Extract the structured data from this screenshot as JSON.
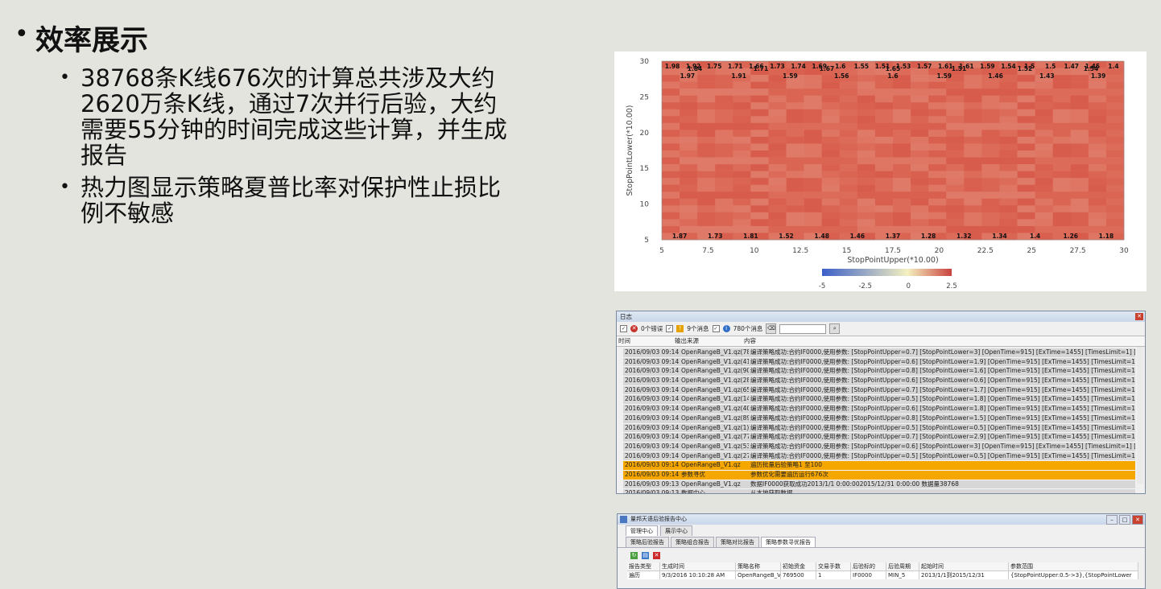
{
  "slide": {
    "title": "效率展示",
    "bullets": [
      "38768条K线676次的计算总共涉及大约2620万条K线，通过7次并行后验，大约需要55分钟的时间完成这些计算，并生成报告",
      "热力图显示策略夏普比率对保护性止损比例不敏感"
    ]
  },
  "heatmap": {
    "xlabel": "StopPointUpper(*10.00)",
    "ylabel": "StopPointLower(*10.00)",
    "x_ticks": [
      "5",
      "7.5",
      "10",
      "12.5",
      "15",
      "17.5",
      "20",
      "22.5",
      "25",
      "27.5",
      "30"
    ],
    "y_ticks": [
      "30",
      "25",
      "20",
      "15",
      "10",
      "5"
    ],
    "colorbar_ticks": [
      "-5",
      "-2.5",
      "0",
      "2.5"
    ],
    "colors": {
      "low": "#3b5fc8",
      "mid": "#f4f0c0",
      "high": "#c9423e",
      "cell": "#db6a58"
    }
  },
  "chart_data": {
    "type": "heatmap",
    "xlabel": "StopPointUpper(*10.00)",
    "ylabel": "StopPointLower(*10.00)",
    "xlim": [
      5,
      30
    ],
    "ylim": [
      5,
      30
    ],
    "color_range": [
      -5,
      2.5
    ],
    "label_samples": {
      "row_30": [
        "1.98",
        "1.92",
        "1.75",
        "1.71",
        "1.66",
        "1.73",
        "1.74",
        "1.69",
        "1.6",
        "1.55",
        "1.51",
        "1.53",
        "1.57",
        "1.61",
        "1.61",
        "1.59",
        "1.54",
        "1.5",
        "1.5",
        "1.47",
        "1.45",
        "1.4"
      ],
      "row_29": [
        "1.84",
        "1.71",
        "1.67",
        "1.65",
        "1.51",
        "1.52",
        "1.54"
      ],
      "row_28": [
        "1.97",
        "1.91",
        "1.59",
        "1.56",
        "1.6",
        "1.59",
        "1.46",
        "1.43",
        "1.39"
      ],
      "row_5": [
        "1.87",
        "1.73",
        "1.81",
        "1.52",
        "1.48",
        "1.46",
        "1.37",
        "1.28",
        "1.32",
        "1.34",
        "1.4",
        "1.26",
        "1.18"
      ]
    }
  },
  "log_window": {
    "title": "日志",
    "filters": {
      "errors": "0个错误",
      "warnings": "9个消息",
      "infos": "780个消息"
    },
    "columns": [
      "时间",
      "输出来源",
      "内容"
    ],
    "rows": [
      [
        "2016/09/03 09:14:10",
        "OpenRangeB_V1.qz(78)",
        "编译策略成功:合约IF0000,使用参数: [StopPointUpper=0.7] [StopPointLower=3] [OpenTime=915] [ExTime=1455] [TimesLimit=1] [RangeRaito=0.3]"
      ],
      [
        "2016/09/03 09:14:10",
        "OpenRangeB_V1.qz(41)",
        "编译策略成功:合约IF0000,使用参数: [StopPointUpper=0.6] [StopPointLower=1.9] [OpenTime=915] [ExTime=1455] [TimesLimit=1] [RangeRaito=0.3]"
      ],
      [
        "2016/09/03 09:14:10",
        "OpenRangeB_V1.qz(90)",
        "编译策略成功:合约IF0000,使用参数: [StopPointUpper=0.8] [StopPointLower=1.6] [OpenTime=915] [ExTime=1455] [TimesLimit=1] [RangeRaito=0.3]"
      ],
      [
        "2016/09/03 09:14:10",
        "OpenRangeB_V1.qz(28)",
        "编译策略成功:合约IF0000,使用参数: [StopPointUpper=0.6] [StopPointLower=0.6] [OpenTime=915] [ExTime=1455] [TimesLimit=1] [RangeRaito=0.3]"
      ],
      [
        "2016/09/03 09:14:09",
        "OpenRangeB_V1.qz(65)",
        "编译策略成功:合约IF0000,使用参数: [StopPointUpper=0.7] [StopPointLower=1.7] [OpenTime=915] [ExTime=1455] [TimesLimit=1] [RangeRaito=0.3]"
      ],
      [
        "2016/09/03 09:14:09",
        "OpenRangeB_V1.qz(14)",
        "编译策略成功:合约IF0000,使用参数: [StopPointUpper=0.5] [StopPointLower=1.8] [OpenTime=915] [ExTime=1455] [TimesLimit=1] [RangeRaito=0.3]"
      ],
      [
        "2016/09/03 09:14:09",
        "OpenRangeB_V1.qz(40)",
        "编译策略成功:合约IF0000,使用参数: [StopPointUpper=0.6] [StopPointLower=1.8] [OpenTime=915] [ExTime=1455] [TimesLimit=1] [RangeRaito=0.3]"
      ],
      [
        "2016/09/03 09:14:09",
        "OpenRangeB_V1.qz(89)",
        "编译策略成功:合约IF0000,使用参数: [StopPointUpper=0.8] [StopPointLower=1.5] [OpenTime=915] [ExTime=1455] [TimesLimit=1] [RangeRaito=0.3]"
      ],
      [
        "2016/09/03 09:14:09",
        "OpenRangeB_V1.qz(1)",
        "编译策略成功:合约IF0000,使用参数: [StopPointUpper=0.5] [StopPointLower=0.5] [OpenTime=915] [ExTime=1455] [TimesLimit=1] [RangeRaito=0.3]"
      ],
      [
        "2016/09/03 09:14:09",
        "OpenRangeB_V1.qz(77)",
        "编译策略成功:合约IF0000,使用参数: [StopPointUpper=0.7] [StopPointLower=2.9] [OpenTime=915] [ExTime=1455] [TimesLimit=1] [RangeRaito=0.3]"
      ],
      [
        "2016/09/03 09:14:09",
        "OpenRangeB_V1.qz(53)",
        "编译策略成功:合约IF0000,使用参数: [StopPointUpper=0.6] [StopPointLower=3] [OpenTime=915] [ExTime=1455] [TimesLimit=1] [RangeRaito=0.3]"
      ],
      [
        "2016/09/03 09:14:09",
        "OpenRangeB_V1.qz(27)",
        "编译策略成功:合约IF0000,使用参数: [StopPointUpper=0.5] [StopPointLower=0.5] [OpenTime=915] [ExTime=1455] [TimesLimit=1] [RangeRaito=0.3]"
      ],
      [
        "2016/09/03 09:14:08",
        "OpenRangeB_V1.qz",
        "遍历批量后验策略1 至100"
      ],
      [
        "2016/09/03 09:14:08",
        "参数寻优",
        "参数优化需要遍历运行676次"
      ],
      [
        "2016/09/03 09:13:57",
        "OpenRangeB_V1.qz",
        "数据IF0000获取成功2013/1/1 0:00:002015/12/31 0:00:00 数据量38768"
      ],
      [
        "2016/09/03 09:13:48",
        "数据中心",
        "从本地获取数据"
      ]
    ],
    "highlight_rows": [
      12,
      13
    ],
    "colors": {
      "row": "#d7d7d7",
      "highlight": "#f5a700"
    }
  },
  "report_window": {
    "title": "量邦天语后验报告中心",
    "top_tabs": [
      "管理中心",
      "展示中心"
    ],
    "tabs": [
      "策略后验报告",
      "策略组合报告",
      "策略对比报告",
      "策略参数寻优报告"
    ],
    "columns": [
      "报告类型",
      "生成时间",
      "策略名称",
      "初始资金",
      "交易手数",
      "后验标的",
      "后验周期",
      "起始时间",
      "参数范围"
    ],
    "row": [
      "遍历",
      "9/3/2016 10:10:28 AM",
      "OpenRangeB_V1",
      "769500",
      "1",
      "IF0000",
      "MIN_5",
      "2013/1/1到2015/12/31",
      "{StopPointUpper:0.5->3},{StopPointLower"
    ]
  }
}
